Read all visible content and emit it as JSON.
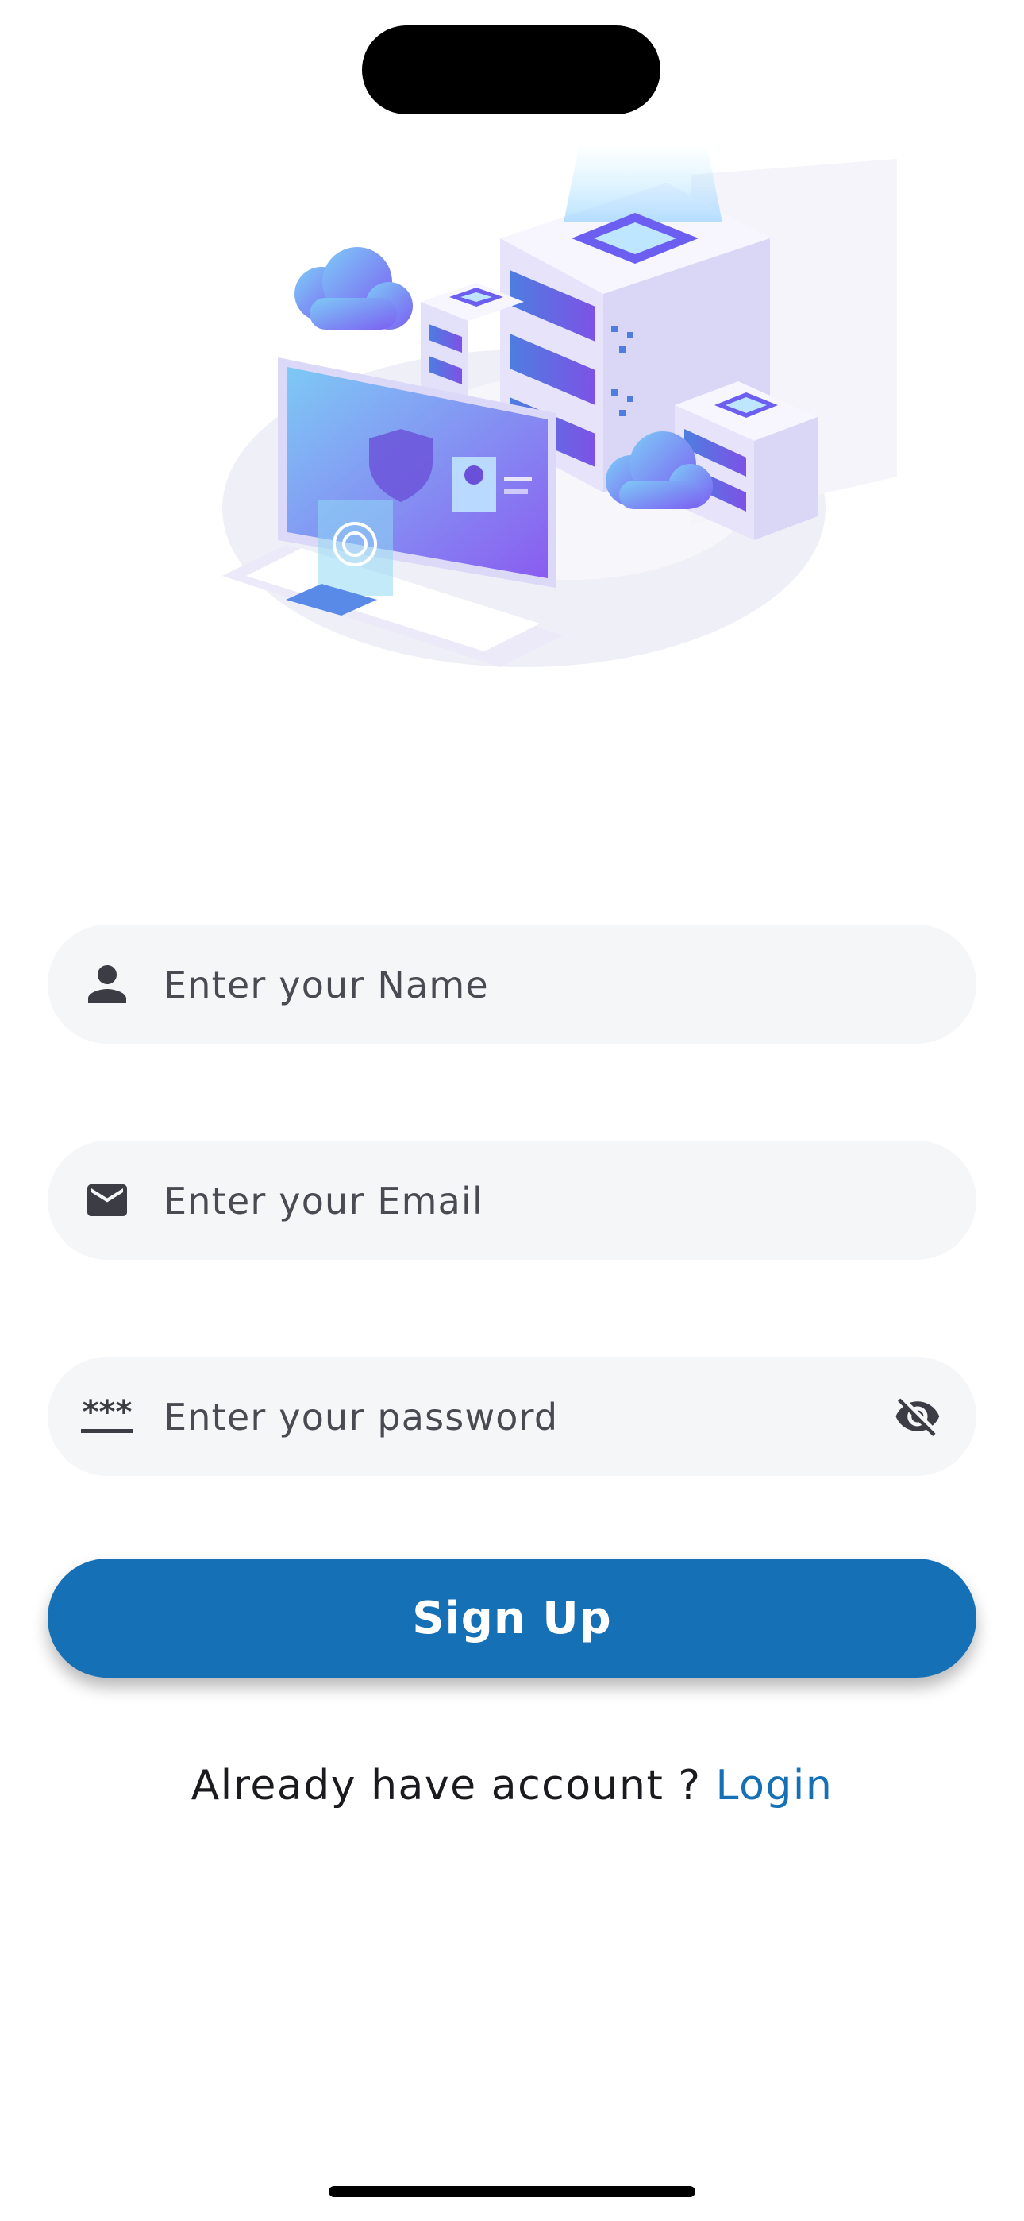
{
  "form": {
    "name_placeholder": "Enter your Name",
    "email_placeholder": "Enter your Email",
    "password_placeholder": "Enter your password",
    "password_mask_icon_text": "***",
    "name_icon": "person-icon",
    "email_icon": "mail-icon",
    "password_icon": "password-icon",
    "visibility_icon": "visibility-off-icon"
  },
  "signup": {
    "button_label": "Sign Up"
  },
  "login_prompt": {
    "text": "Already have account ?",
    "link_label": "Login"
  },
  "colors": {
    "accent": "#1670b6",
    "field_background": "#f5f6f8",
    "text": "#1b1b1f",
    "icon": "#3c3c44"
  },
  "illustration": "server-security-illustration"
}
